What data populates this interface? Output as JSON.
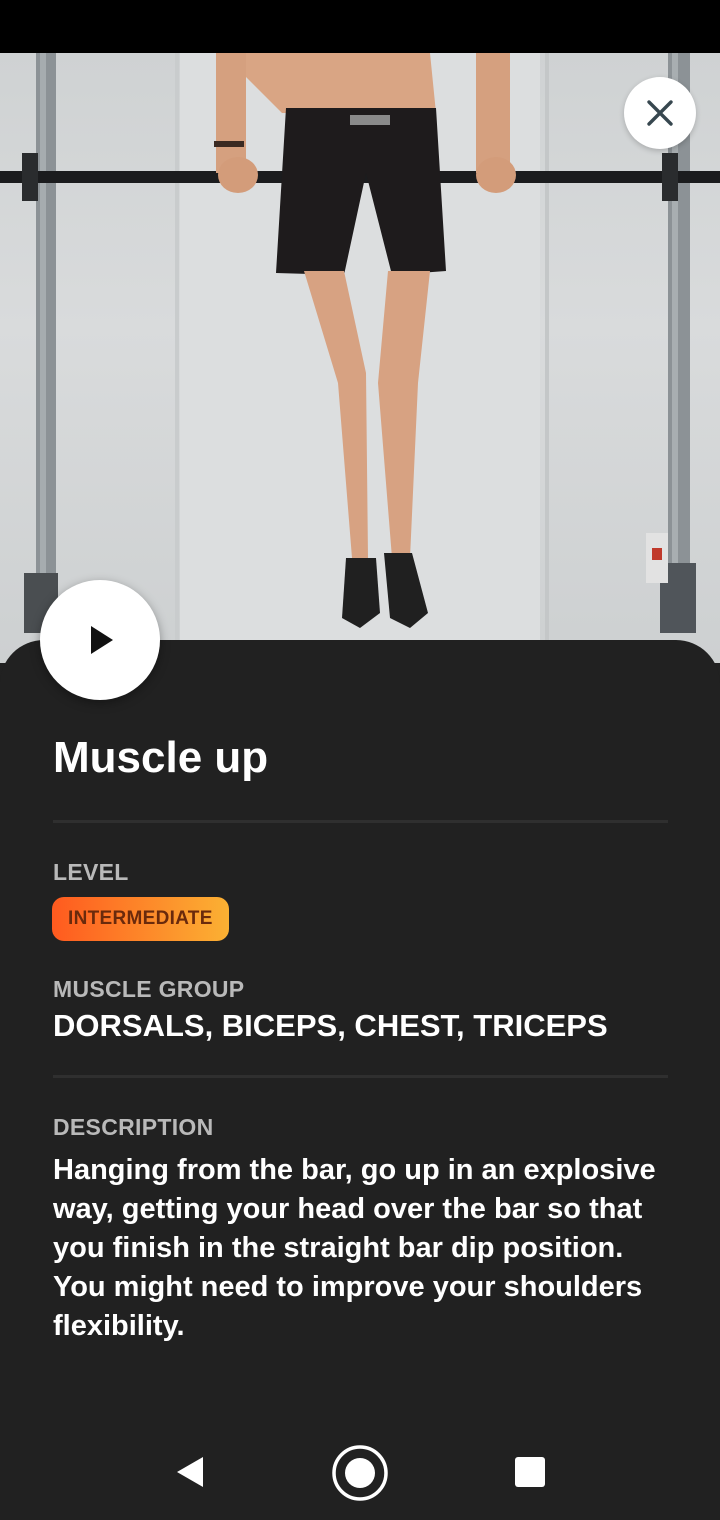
{
  "exercise": {
    "title": "Muscle up",
    "level_label": "LEVEL",
    "level_value": "INTERMEDIATE",
    "muscle_label": "MUSCLE GROUP",
    "muscle_value": "DORSALS, BICEPS, CHEST, TRICEPS",
    "description_label": "DESCRIPTION",
    "description": "Hanging from the bar, go up in an explosive way, getting your head over the bar so that you finish in the straight bar dip position. You might need to improve your shoulders flexibility."
  },
  "icons": {
    "close": "close-icon",
    "play": "play-icon",
    "back": "back-triangle-icon",
    "home": "home-circle-icon",
    "recents": "recents-square-icon"
  },
  "colors": {
    "sheet_background": "#212121",
    "badge_gradient_start": "#ff5a1f",
    "badge_gradient_end": "#fbb133",
    "label_gray": "#b9b9b9"
  }
}
